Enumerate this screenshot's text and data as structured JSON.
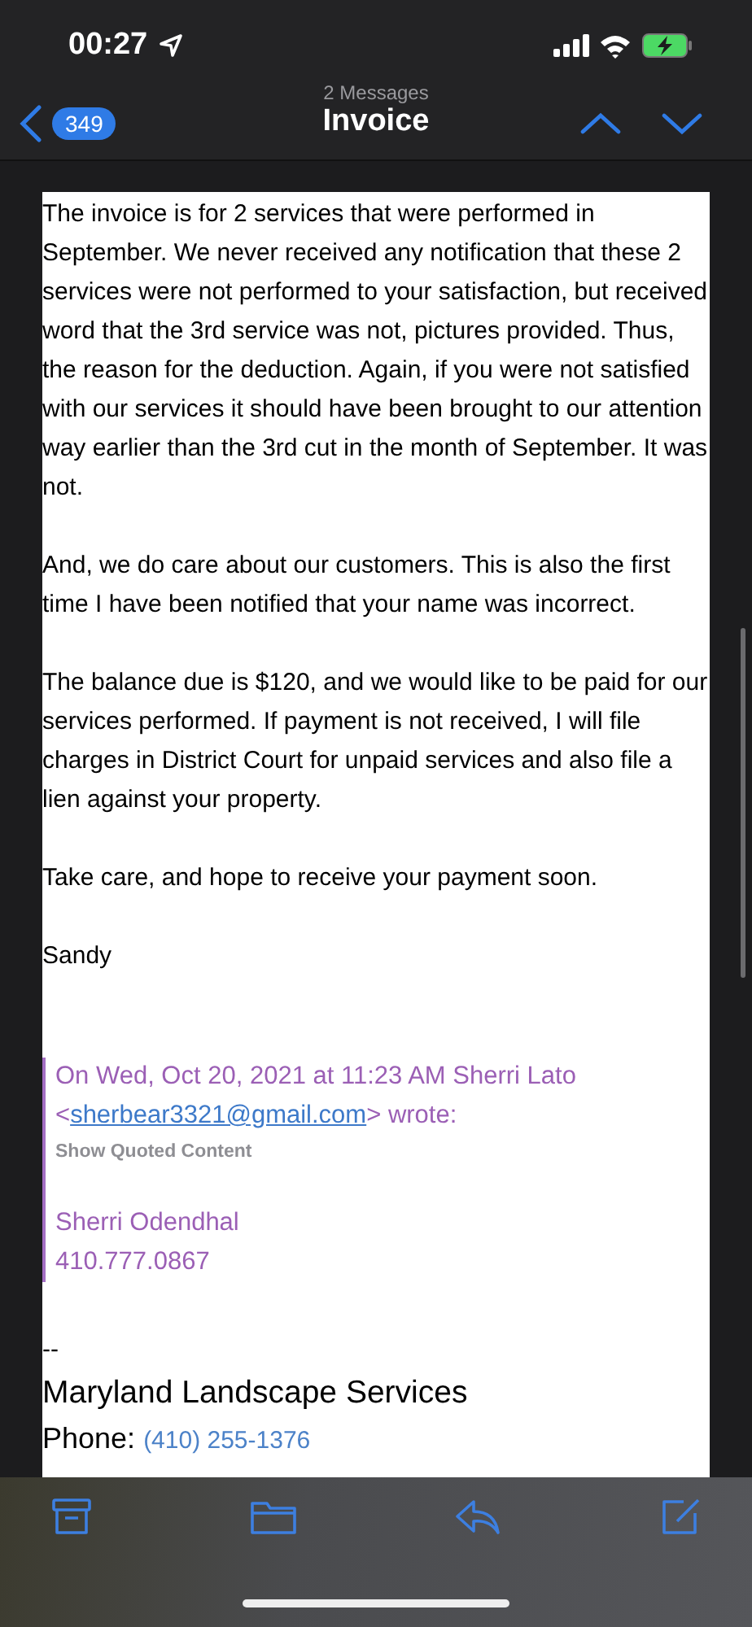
{
  "status_bar": {
    "time": "00:27"
  },
  "nav": {
    "back_badge": "349",
    "subtitle": "2 Messages",
    "title": "Invoice"
  },
  "message": {
    "paragraphs": [
      "The invoice is for 2 services that were performed in September.  We never received any notification that these 2 services were not performed  to your satisfaction, but received word that the 3rd service was not, pictures provided.  Thus, the reason for the deduction.  Again, if you were not satisfied with our services it should have been brought to our attention way earlier than the 3rd cut in the month of September.  It was not.",
      "And, we do care about our customers.  This is also the first time I have been notified that your name was incorrect.",
      "The balance due is $120, and we would like to be paid for our services performed.  If payment is not received, I will file charges in District Court for unpaid services and also file a lien against your property.",
      "Take care, and hope to receive your payment soon.",
      "Sandy"
    ],
    "quote": {
      "header_before": "On Wed, Oct 20, 2021 at 11:23 AM Sherri Lato <",
      "header_link": "sherbear3321@gmail.com",
      "header_after": "> wrote:",
      "show_quoted": "Show Quoted Content",
      "lines": [
        "Sherri Odendhal",
        "410.777.0867"
      ]
    },
    "signature": {
      "separator": "--",
      "company": "Maryland Landscape Services",
      "phone_label": "Phone:",
      "phone_link": "(410) 255-1376"
    }
  }
}
